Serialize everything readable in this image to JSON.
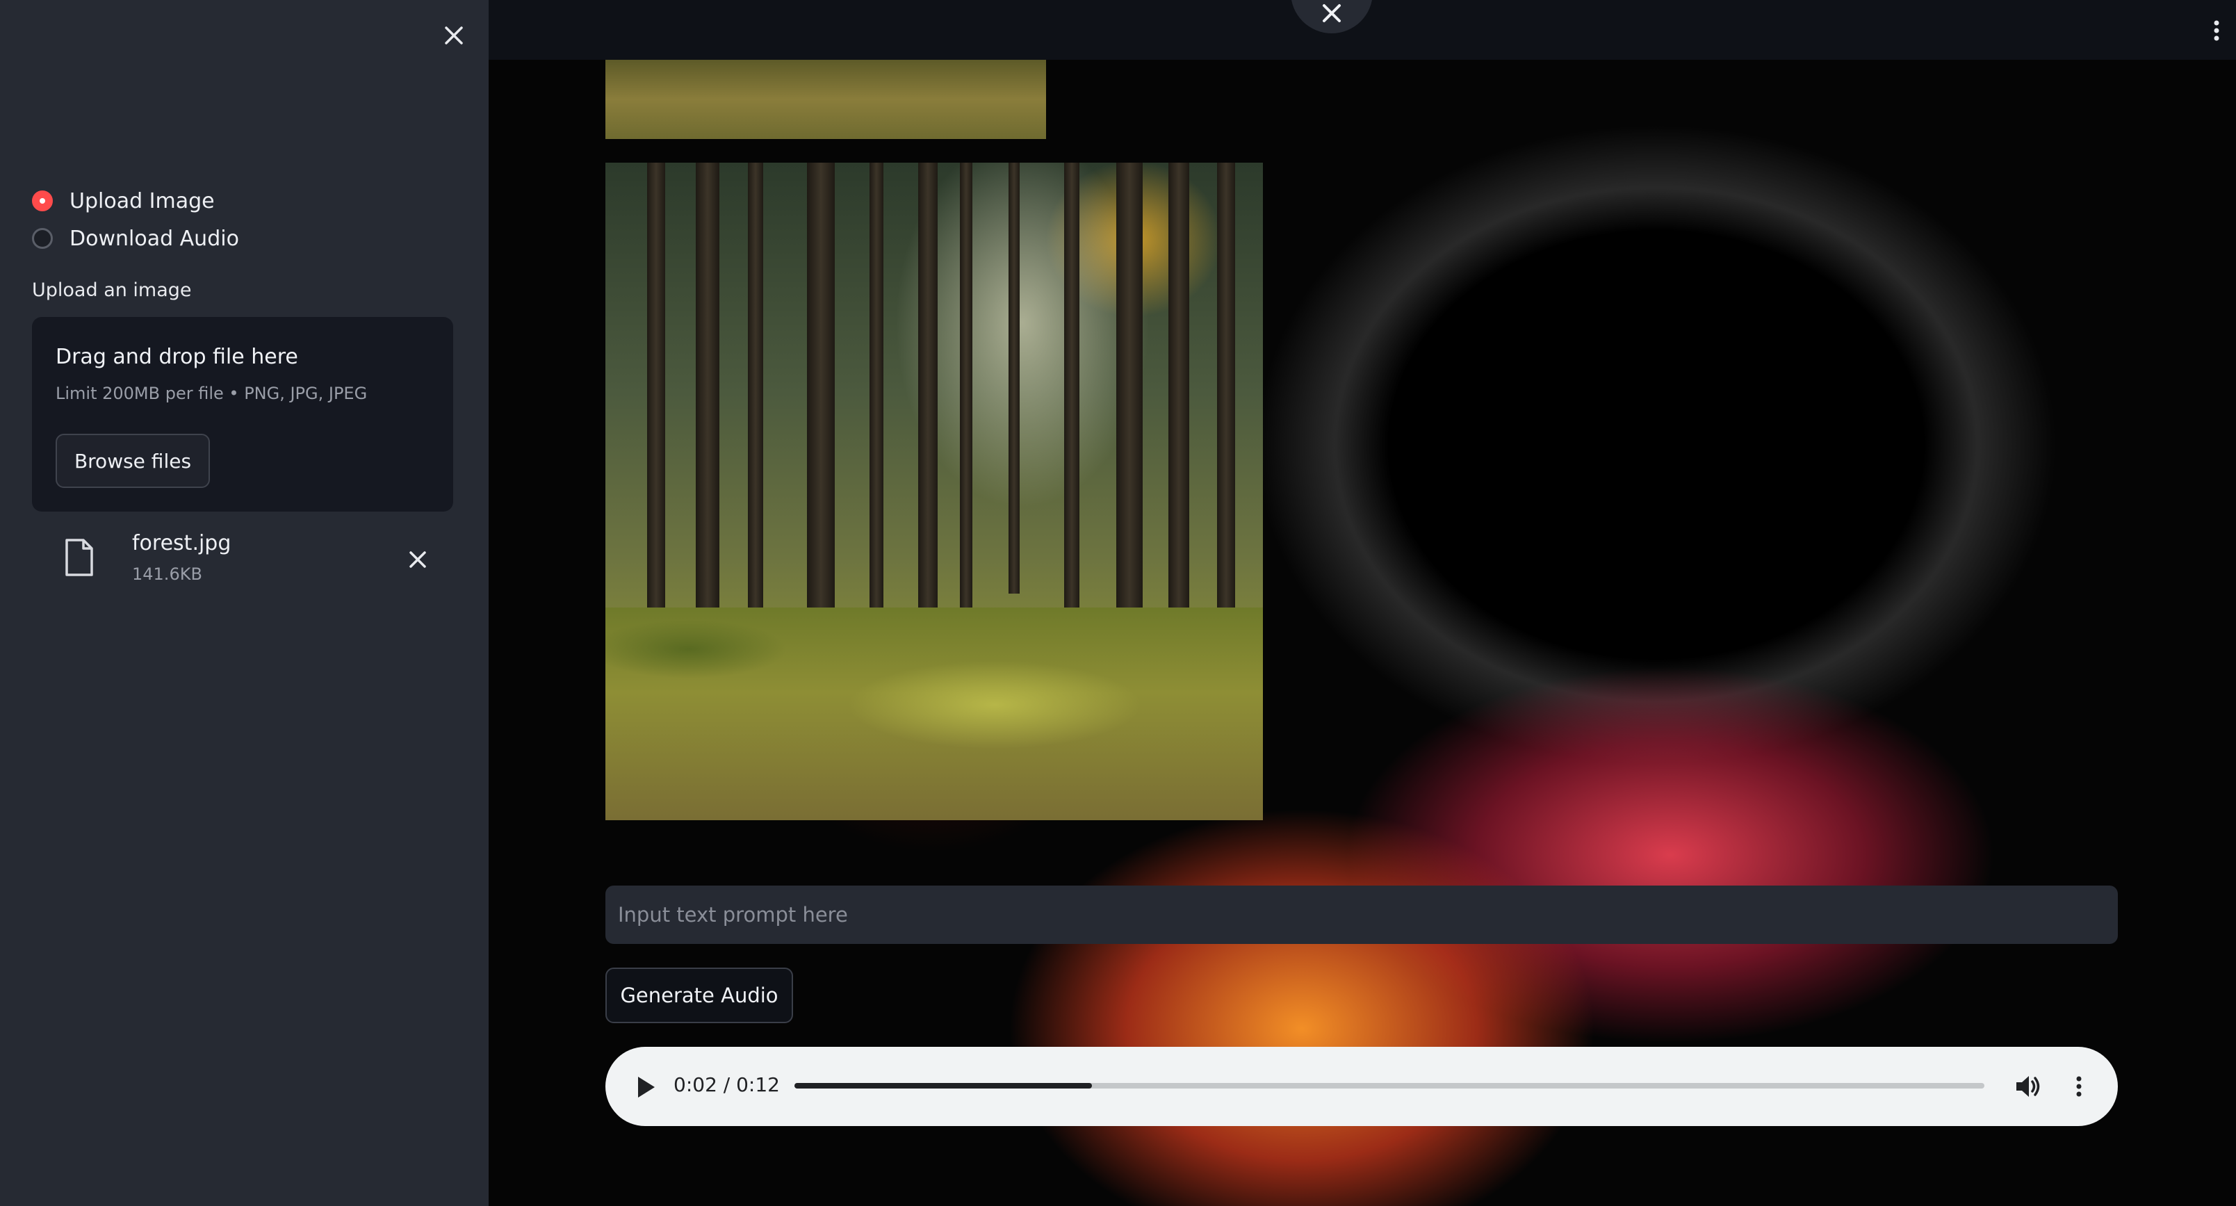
{
  "sidebar": {
    "close_icon": "close-icon",
    "radio_options": [
      {
        "label": "Upload Image",
        "selected": true
      },
      {
        "label": "Download Audio",
        "selected": false
      }
    ],
    "uploader": {
      "title": "Upload an image",
      "dropzone_title": "Drag and drop file here",
      "dropzone_limit": "Limit 200MB per file • PNG, JPG, JPEG",
      "browse_label": "Browse files"
    },
    "file": {
      "name": "forest.jpg",
      "size": "141.6KB",
      "icon": "file-icon",
      "remove_icon": "close-icon"
    }
  },
  "main": {
    "topbar": {
      "close_icon": "close-icon",
      "menu_icon": "kebab-menu-icon"
    },
    "image": {
      "content": "forest photo"
    },
    "prompt": {
      "placeholder": "Input text prompt here",
      "value": ""
    },
    "generate_label": "Generate Audio",
    "audio_player": {
      "time": "0:02 / 0:12",
      "progress": 0.25,
      "play_icon": "play-icon",
      "volume_icon": "volume-icon",
      "more_icon": "kebab-menu-icon"
    }
  },
  "colors": {
    "accent": "#ff4b4b",
    "sidebar_bg": "#262a33",
    "dropzone_bg": "#151821",
    "topbar_bg": "#0e1117"
  }
}
